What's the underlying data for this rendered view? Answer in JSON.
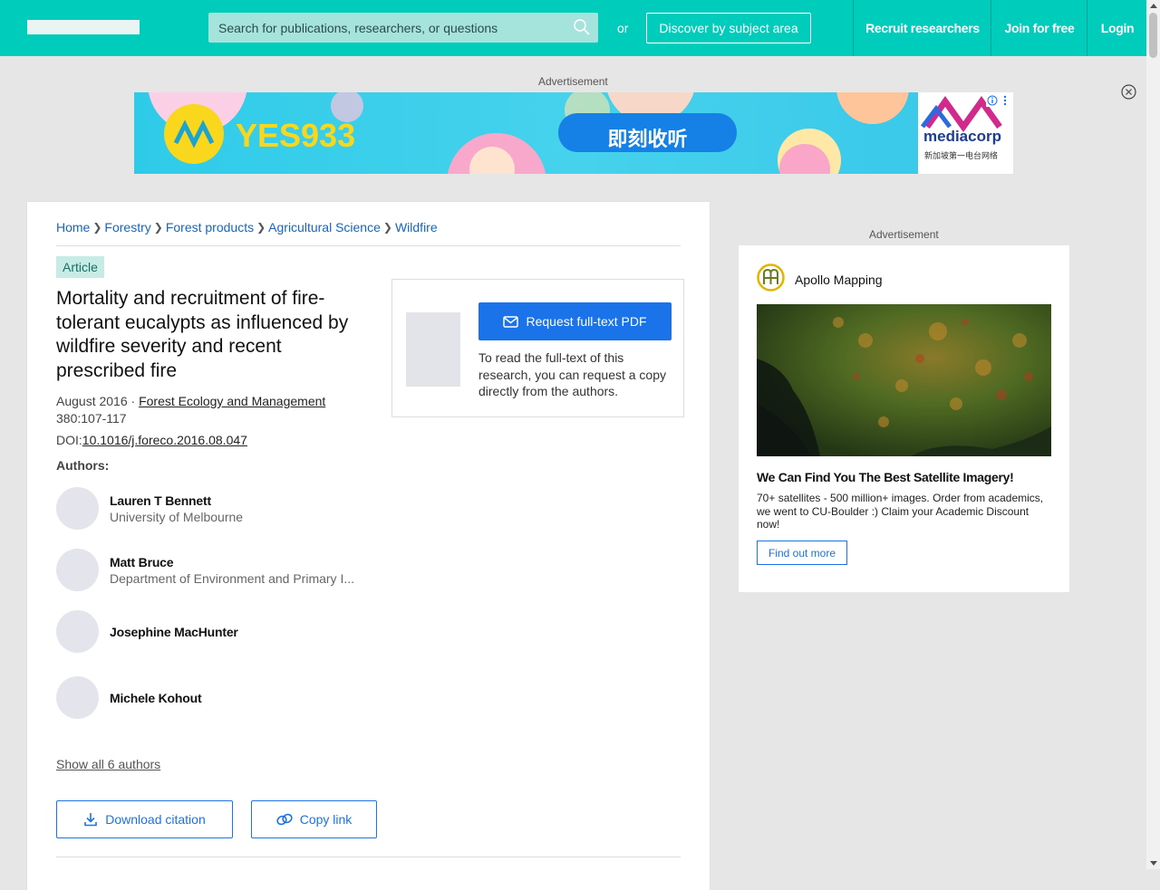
{
  "header": {
    "search_placeholder": "Search for publications, researchers, or questions",
    "or_label": "or",
    "discover_label": "Discover by subject area",
    "recruit_label": "Recruit researchers",
    "join_label": "Join for free",
    "login_label": "Login"
  },
  "ads": {
    "top_label": "Advertisement",
    "side_label": "Advertisement",
    "banner": {
      "station": "YES933",
      "cta": "即刻收听",
      "brand": "mediacorp",
      "brand_sub": "新加坡第一电台网络"
    },
    "side": {
      "brand": "Apollo Mapping",
      "headline": "We Can Find You The Best Satellite Imagery!",
      "description": "70+ satellites - 500 million+ images. Order from academics, we went to CU-Boulder :) Claim your Academic Discount now!",
      "cta": "Find out more"
    }
  },
  "breadcrumb": [
    "Home",
    "Forestry",
    "Forest products",
    "Agricultural Science",
    "Wildfire"
  ],
  "article": {
    "type": "Article",
    "title": "Mortality and recruitment of fire-tolerant eucalypts as influenced by wildfire severity and recent prescribed fire",
    "date": "August 2016 · ",
    "journal": "Forest Ecology and Management",
    "pages": "380:107-117",
    "doi_prefix": "DOI:",
    "doi": "10.1016/j.foreco.2016.08.047",
    "authors_label": "Authors:",
    "authors": [
      {
        "name": "Lauren T Bennett",
        "institution": "University of Melbourne"
      },
      {
        "name": "Matt Bruce",
        "institution": "Department of Environment and Primary I..."
      },
      {
        "name": "Josephine MacHunter",
        "institution": ""
      },
      {
        "name": "Michele Kohout",
        "institution": ""
      }
    ],
    "show_all": "Show all 6 authors",
    "download_citation": "Download citation",
    "copy_link": "Copy link"
  },
  "request": {
    "button": "Request full-text PDF",
    "text": "To read the full-text of this research, you can request a copy directly from the authors."
  },
  "colors": {
    "header": "#00ccbb",
    "primary": "#1a73e8",
    "badge_bg": "#c7ece6"
  }
}
